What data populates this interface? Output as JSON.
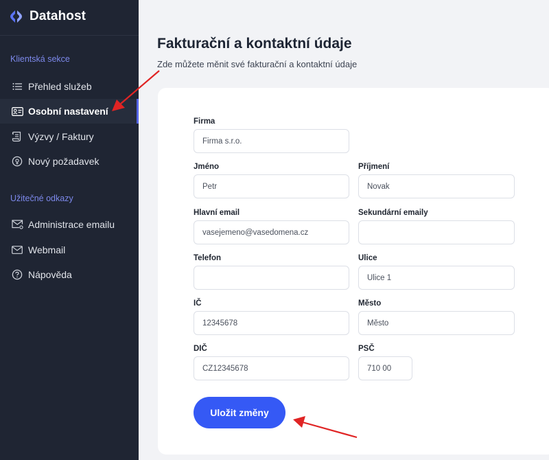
{
  "brand": {
    "name": "Datahost"
  },
  "sidebar": {
    "sections": [
      {
        "title": "Klientská sekce",
        "items": [
          {
            "label": "Přehled služeb",
            "icon": "list-icon",
            "active": false
          },
          {
            "label": "Osobní nastavení",
            "icon": "id-card-icon",
            "active": true
          },
          {
            "label": "Výzvy / Faktury",
            "icon": "invoice-icon",
            "active": false
          },
          {
            "label": "Nový požadavek",
            "icon": "support-icon",
            "active": false
          }
        ]
      },
      {
        "title": "Užitečné odkazy",
        "items": [
          {
            "label": "Administrace emailu",
            "icon": "mail-admin-icon",
            "active": false
          },
          {
            "label": "Webmail",
            "icon": "envelope-icon",
            "active": false
          },
          {
            "label": "Nápověda",
            "icon": "help-icon",
            "active": false
          }
        ]
      }
    ]
  },
  "page": {
    "title": "Fakturační a kontaktní údaje",
    "subtitle": "Zde můžete měnit své fakturační a kontaktní údaje"
  },
  "form": {
    "fields": {
      "firma": {
        "label": "Firma",
        "value": "Firma s.r.o."
      },
      "jmeno": {
        "label": "Jméno",
        "value": "Petr"
      },
      "prijmeni": {
        "label": "Příjmení",
        "value": "Novak"
      },
      "hlavni_email": {
        "label": "Hlavní email",
        "value": "vasejemeno@vasedomena.cz"
      },
      "sekundarni_emaily": {
        "label": "Sekundární emaily",
        "value": ""
      },
      "telefon": {
        "label": "Telefon",
        "value": ""
      },
      "ulice": {
        "label": "Ulice",
        "value": "Ulice 1"
      },
      "ic": {
        "label": "IČ",
        "value": "12345678"
      },
      "mesto": {
        "label": "Město",
        "value": "Město"
      },
      "dic": {
        "label": "DIČ",
        "value": "CZ12345678"
      },
      "psc": {
        "label": "PSČ",
        "value": "710 00"
      }
    },
    "save_label": "Uložit změny"
  },
  "colors": {
    "sidebar_bg": "#1f2533",
    "accent": "#3559f5",
    "section_title": "#7c88ea",
    "annotation_arrow": "#e02424"
  }
}
